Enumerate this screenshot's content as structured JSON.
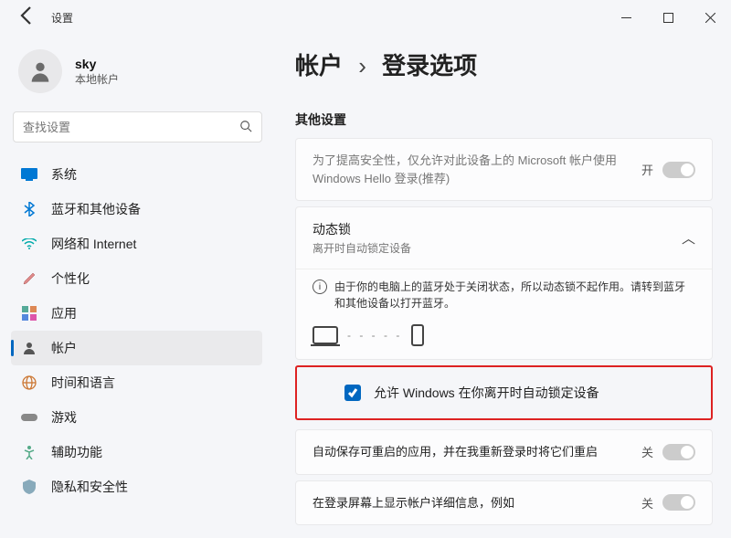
{
  "window": {
    "title": "设置"
  },
  "user": {
    "name": "sky",
    "subtitle": "本地帐户"
  },
  "search": {
    "placeholder": "查找设置"
  },
  "nav": [
    {
      "label": "系统",
      "key": "system"
    },
    {
      "label": "蓝牙和其他设备",
      "key": "bluetooth"
    },
    {
      "label": "网络和 Internet",
      "key": "network"
    },
    {
      "label": "个性化",
      "key": "personalize"
    },
    {
      "label": "应用",
      "key": "apps"
    },
    {
      "label": "帐户",
      "key": "accounts"
    },
    {
      "label": "时间和语言",
      "key": "time"
    },
    {
      "label": "游戏",
      "key": "gaming"
    },
    {
      "label": "辅助功能",
      "key": "accessibility"
    },
    {
      "label": "隐私和安全性",
      "key": "privacy"
    }
  ],
  "breadcrumb": {
    "parent": "帐户",
    "current": "登录选项"
  },
  "section_other": "其他设置",
  "hello": {
    "text": "为了提高安全性，仅允许对此设备上的 Microsoft 帐户使用 Windows Hello 登录(推荐)",
    "state": "开"
  },
  "dynlock": {
    "title": "动态锁",
    "subtitle": "离开时自动锁定设备",
    "info": "由于你的电脑上的蓝牙处于关闭状态，所以动态锁不起作用。请转到蓝牙和其他设备以打开蓝牙。",
    "checkbox_label": "允许 Windows 在你离开时自动锁定设备"
  },
  "autorestart": {
    "text": "自动保存可重启的应用，并在我重新登录时将它们重启",
    "state": "关"
  },
  "lockscreen": {
    "text": "在登录屏幕上显示帐户详细信息，例如",
    "state": "关"
  }
}
